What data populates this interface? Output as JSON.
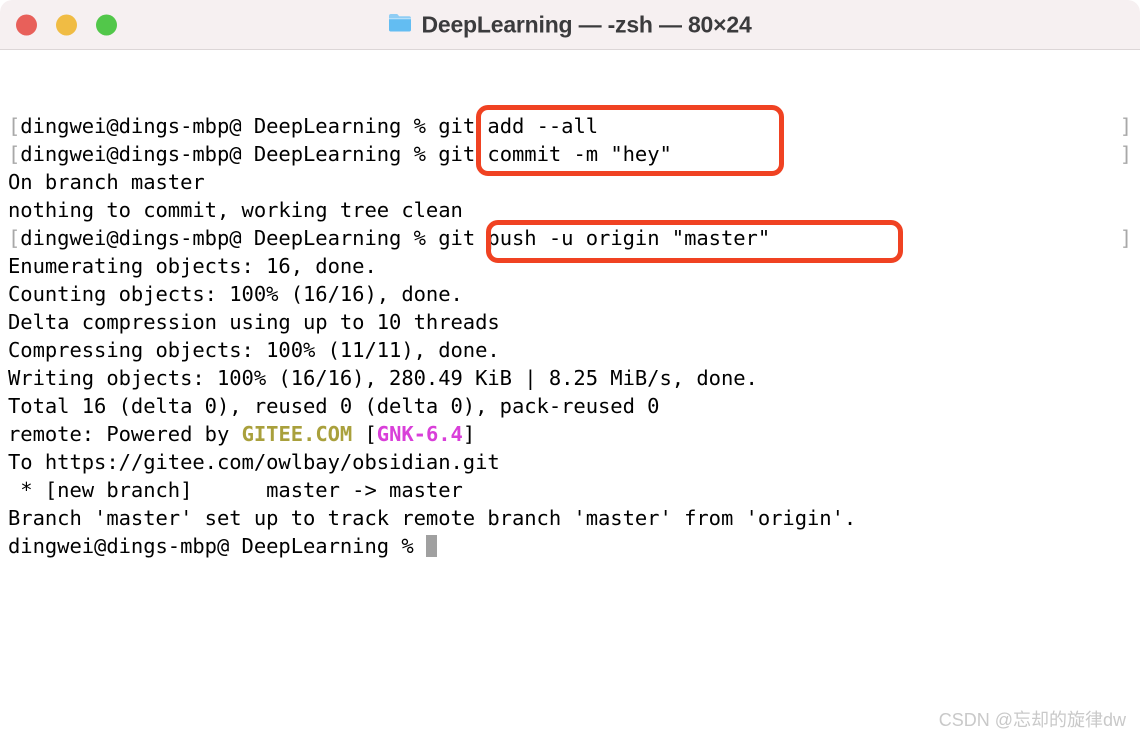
{
  "window": {
    "title": "DeepLearning — -zsh — 80×24",
    "folder_icon": "folder-icon",
    "traffic_lights": [
      {
        "name": "close",
        "color": "#e8605a",
        "label": "Close"
      },
      {
        "name": "minimize",
        "color": "#f0bc44",
        "label": "Minimize"
      },
      {
        "name": "zoom",
        "color": "#52c74a",
        "label": "Zoom"
      }
    ],
    "titlebar_bg": "#f6f0f1",
    "body_bg": "#ffffff"
  },
  "terminal": {
    "prompt": "[dingwei@dings-mbp@ DeepLearning % ",
    "prompt_plain": "dingwei@dings-mbp@ DeepLearning % ",
    "end_bracket": "]",
    "cursor": "block-cursor",
    "lines": [
      {
        "id": "line-1",
        "text": "[dingwei@dings-mbp@ DeepLearning % git add --all"
      },
      {
        "id": "line-2",
        "text": "[dingwei@dings-mbp@ DeepLearning % git commit -m \"hey\""
      },
      {
        "id": "line-3",
        "text": "On branch master"
      },
      {
        "id": "line-4",
        "text": "nothing to commit, working tree clean"
      },
      {
        "id": "line-5",
        "text": "[dingwei@dings-mbp@ DeepLearning % git push -u origin \"master\""
      },
      {
        "id": "line-6",
        "text": "Enumerating objects: 16, done."
      },
      {
        "id": "line-7",
        "text": "Counting objects: 100% (16/16), done."
      },
      {
        "id": "line-8",
        "text": "Delta compression using up to 10 threads"
      },
      {
        "id": "line-9",
        "text": "Compressing objects: 100% (11/11), done."
      },
      {
        "id": "line-10",
        "text": "Writing objects: 100% (16/16), 280.49 KiB | 8.25 MiB/s, done."
      },
      {
        "id": "line-11",
        "text": "Total 16 (delta 0), reused 0 (delta 0), pack-reused 0"
      },
      {
        "id": "line-12",
        "text": "remote: Powered by GITEE.COM [GNK-6.4]"
      },
      {
        "id": "line-13",
        "text": "To https://gitee.com/owlbay/obsidian.git"
      },
      {
        "id": "line-14",
        "text": " * [new branch]      master -> master"
      },
      {
        "id": "line-15",
        "text": "Branch 'master' set up to track remote branch 'master' from 'origin'."
      },
      {
        "id": "line-16",
        "text": "dingwei@dings-mbp@ DeepLearning % "
      }
    ],
    "segments": {
      "l1_prompt": "dingwei@dings-mbp@ DeepLearning % ",
      "l1_cmd": "git add --all",
      "l2_prompt": "dingwei@dings-mbp@ DeepLearning % ",
      "l2_cmd": "git commit -m \"hey\"",
      "l3": "On branch master",
      "l4": "nothing to commit, working tree clean",
      "l5_prompt": "dingwei@dings-mbp@ DeepLearning % ",
      "l5_cmd": "git push -u origin \"master\"",
      "l6": "Enumerating objects: 16, done.",
      "l7": "Counting objects: 100% (16/16), done.",
      "l8": "Delta compression using up to 10 threads",
      "l9": "Compressing objects: 100% (11/11), done.",
      "l10": "Writing objects: 100% (16/16), 280.49 KiB | 8.25 MiB/s, done.",
      "l11": "Total 16 (delta 0), reused 0 (delta 0), pack-reused 0",
      "l12_a": "remote: Powered by ",
      "l12_gitee": "GITEE.COM",
      "l12_b": " [",
      "l12_gnk": "GNK-6.4",
      "l12_c": "]",
      "l13": "To https://gitee.com/owlbay/obsidian.git",
      "l14": " * [new branch]      master -> master",
      "l15": "Branch 'master' set up to track remote branch 'master' from 'origin'.",
      "l16_prompt": "dingwei@dings-mbp@ DeepLearning % ",
      "open_bracket": "["
    },
    "colors": {
      "text": "#000000",
      "bracket": "#a8a8a8",
      "gitee": "#a9a03c",
      "gnk": "#d93fd9",
      "cursor": "#a0a0a0"
    }
  },
  "annotations": {
    "highlight_color": "#f04222",
    "boxes": [
      {
        "name": "git-add-commit-highlight",
        "commands": [
          "git add --all",
          "git commit -m \"hey\""
        ]
      },
      {
        "name": "git-push-highlight",
        "commands": [
          "git push -u origin \"master\""
        ]
      }
    ]
  },
  "watermark": {
    "text": "CSDN @忘却的旋律dw"
  }
}
